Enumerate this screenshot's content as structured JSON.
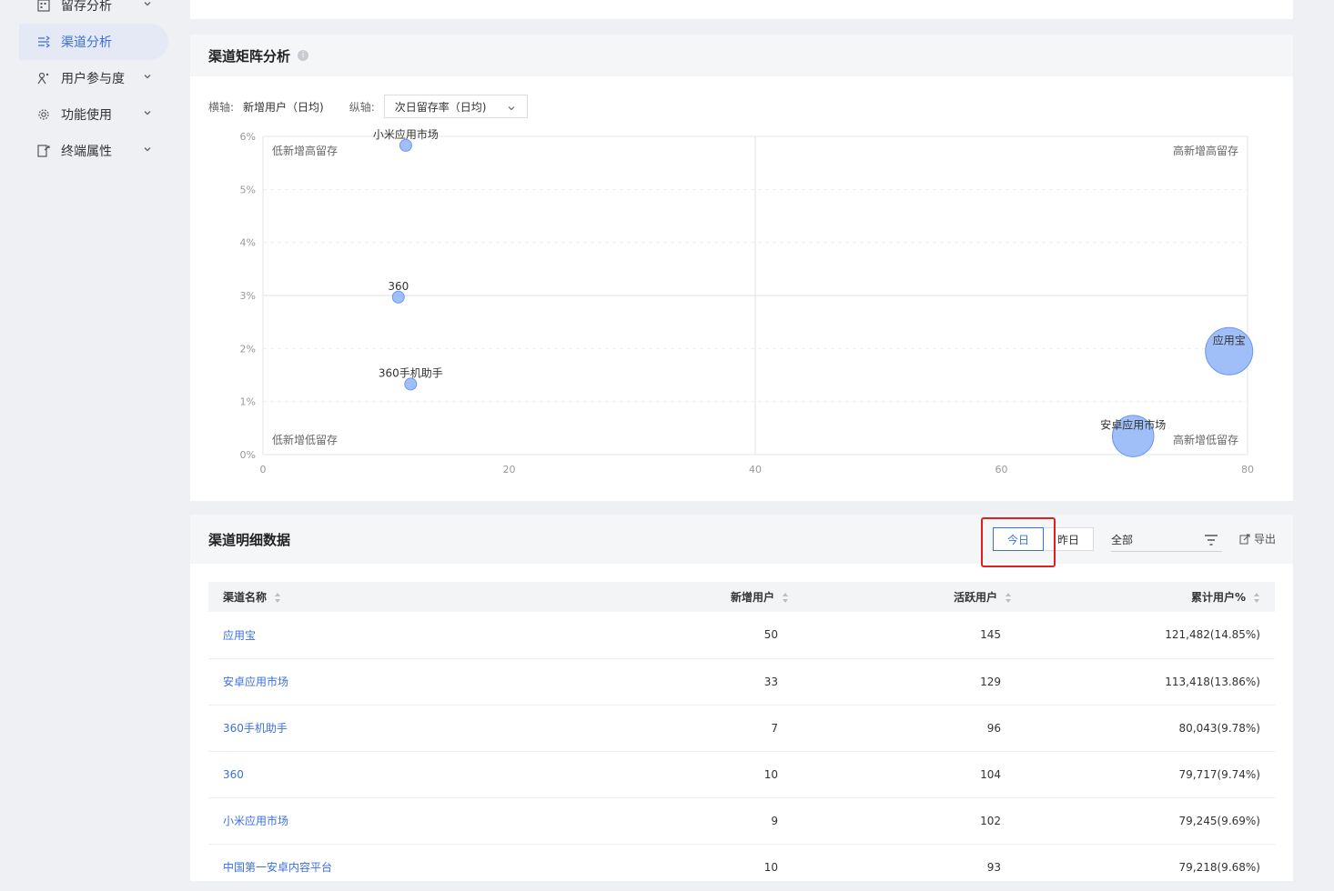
{
  "sidebar": {
    "items": [
      {
        "label": "留存分析",
        "icon": "retention-grid-icon"
      },
      {
        "label": "渠道分析",
        "icon": "channel-icon",
        "active": true
      },
      {
        "label": "用户参与度",
        "icon": "user-engagement-icon"
      },
      {
        "label": "功能使用",
        "icon": "gear-icon"
      },
      {
        "label": "终端属性",
        "icon": "device-icon"
      }
    ]
  },
  "matrix": {
    "title": "渠道矩阵分析",
    "x_axis_label": "横轴:",
    "x_axis_value": "新增用户（日均)",
    "y_axis_label": "纵轴:",
    "y_axis_value": "次日留存率（日均)",
    "quadrants": {
      "top_left": "低新增高留存",
      "top_right": "高新增高留存",
      "bottom_left": "低新增低留存",
      "bottom_right": "高新增低留存"
    }
  },
  "chart_data": {
    "type": "scatter",
    "xlim": [
      0,
      80
    ],
    "ylim": [
      0,
      6
    ],
    "x_ticks": [
      "0",
      "20",
      "40",
      "60",
      "80"
    ],
    "y_ticks": [
      "0%",
      "1%",
      "2%",
      "3%",
      "4%",
      "5%",
      "6%"
    ],
    "divider_x": 40,
    "divider_y": 3,
    "points": [
      {
        "label": "小米应用市场",
        "x": 11.6,
        "y": 5.83,
        "size": 1
      },
      {
        "label": "360",
        "x": 11,
        "y": 2.97,
        "size": 1
      },
      {
        "label": "360手机助手",
        "x": 12,
        "y": 1.33,
        "size": 1
      },
      {
        "label": "应用宝",
        "x": 78.5,
        "y": 1.95,
        "size": 4
      },
      {
        "label": "安卓应用市场",
        "x": 70.7,
        "y": 0.35,
        "size": 3.5
      }
    ],
    "color": "#8fb4f7",
    "stroke": "#6b97f0"
  },
  "detail": {
    "title": "渠道明细数据",
    "today": "今日",
    "yesterday": "昨日",
    "range_value": "全部",
    "export": "导出",
    "columns": [
      "渠道名称",
      "新增用户",
      "活跃用户",
      "累计用户%"
    ],
    "rows": [
      [
        "应用宝",
        "50",
        "145",
        "121,482(14.85%)"
      ],
      [
        "安卓应用市场",
        "33",
        "129",
        "113,418(13.86%)"
      ],
      [
        "360手机助手",
        "7",
        "96",
        "80,043(9.78%)"
      ],
      [
        "360",
        "10",
        "104",
        "79,717(9.74%)"
      ],
      [
        "小米应用市场",
        "9",
        "102",
        "79,245(9.69%)"
      ],
      [
        "中国第一安卓内容平台",
        "10",
        "93",
        "79,218(9.68%)"
      ]
    ]
  }
}
